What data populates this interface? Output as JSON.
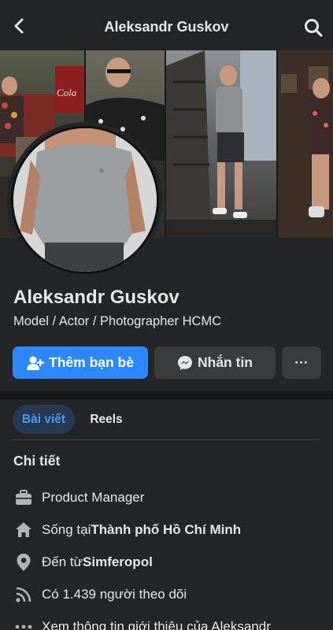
{
  "header": {
    "title": "Aleksandr Guskov"
  },
  "cover": {
    "sign_text": "Cola"
  },
  "profile": {
    "name": "Aleksandr Guskov",
    "bio": "Model / Actor / Photographer HCMC"
  },
  "actions": {
    "add_friend": "Thêm bạn bè",
    "message": "Nhắn tin",
    "more": "···"
  },
  "tabs": [
    {
      "label": "Bài viết",
      "active": true
    },
    {
      "label": "Reels",
      "active": false
    }
  ],
  "details": {
    "title": "Chi tiết",
    "work": "Product Manager",
    "lives_prefix": "Sống tại ",
    "lives_value": "Thành phố Hồ Chí Minh",
    "from_prefix": "Đến từ ",
    "from_value": "Simferopol",
    "followers": "Có 1.439 người theo dõi",
    "see_about": "Xem thông tin giới thiệu của Aleksandr"
  },
  "colors": {
    "background": "#242526",
    "primary_button": "#2d88ff",
    "secondary_button": "#3a3b3c",
    "active_tab_bg": "#263951",
    "active_tab_text": "#4599ff",
    "text": "#e4e6eb",
    "icon": "#b0b3b8"
  },
  "icons": {
    "back": "chevron-left-icon",
    "search": "search-icon",
    "add_friend": "person-plus-icon",
    "message": "messenger-icon",
    "work": "briefcase-icon",
    "lives": "home-icon",
    "from": "location-pin-icon",
    "followers": "rss-feed-icon",
    "see_about": "more-dots-icon"
  }
}
